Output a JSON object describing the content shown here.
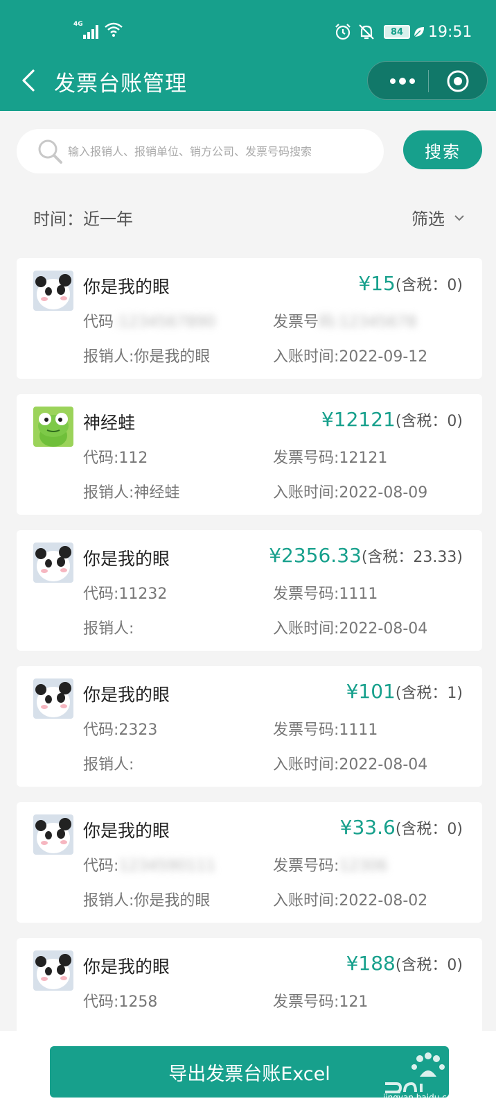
{
  "status_bar": {
    "network": "4G",
    "battery": "84",
    "time": "19:51"
  },
  "nav": {
    "title": "发票台账管理",
    "icons": [
      "back-icon",
      "more-dots-icon",
      "close-target-icon"
    ]
  },
  "search": {
    "placeholder": "输入报销人、报销单位、销方公司、发票号码搜索",
    "value": "",
    "button_label": "搜索"
  },
  "filters": {
    "time_label": "时间：近一年",
    "filter_label": "筛选"
  },
  "invoices": [
    {
      "name": "你是我的眼",
      "avatar": "panda",
      "amount": "¥15",
      "tax": "(含税：0)",
      "code": "代码",
      "invoice_no": "发票号",
      "person": "报销人:你是我的眼",
      "date": "入账时间:2022-09-12"
    },
    {
      "name": "神经蛙",
      "avatar": "frog",
      "amount": "¥12121",
      "tax": "(含税：0)",
      "code": "代码:112",
      "invoice_no": "发票号码:12121",
      "person": "报销人:神经蛙",
      "date": "入账时间:2022-08-09"
    },
    {
      "name": "你是我的眼",
      "avatar": "panda",
      "amount": "¥2356.33",
      "tax": "(含税：23.33)",
      "code": "代码:11232",
      "invoice_no": "发票号码:1111",
      "person": "报销人:",
      "date": "入账时间:2022-08-04"
    },
    {
      "name": "你是我的眼",
      "avatar": "panda",
      "amount": "¥101",
      "tax": "(含税：1)",
      "code": "代码:2323",
      "invoice_no": "发票号码:1111",
      "person": "报销人:",
      "date": "入账时间:2022-08-04"
    },
    {
      "name": "你是我的眼",
      "avatar": "panda",
      "amount": "¥33.6",
      "tax": "(含税：0)",
      "code": "代码:",
      "invoice_no": "发票号码:",
      "person": "报销人:你是我的眼",
      "date": "入账时间:2022-08-02"
    },
    {
      "name": "你是我的眼",
      "avatar": "panda",
      "amount": "¥188",
      "tax": "(含税：0)",
      "code": "代码:1258",
      "invoice_no": "发票号码:121",
      "person": "",
      "date": ""
    }
  ],
  "export_button": "导出发票台账Excel",
  "watermark": {
    "text": "jingyan.baidu.com",
    "logo": "baidu-jingyan-logo"
  },
  "colors": {
    "primary": "#17a08c",
    "background": "#f4f4f4",
    "card": "#ffffff"
  }
}
